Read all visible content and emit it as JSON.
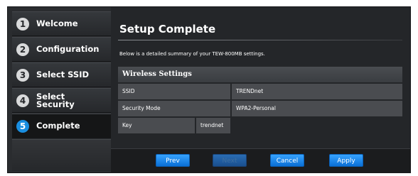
{
  "sidebar": {
    "items": [
      {
        "number": "1",
        "label": "Welcome"
      },
      {
        "number": "2",
        "label": "Configuration"
      },
      {
        "number": "3",
        "label": "Select SSID"
      },
      {
        "number": "4",
        "label": "Select\nSecurity"
      },
      {
        "number": "5",
        "label": "Complete"
      }
    ]
  },
  "main": {
    "title": "Setup Complete",
    "subtitle": "Below is a detailed summary of your TEW-800MB settings.",
    "table": {
      "header": "Wireless Settings",
      "rows": [
        {
          "label": "SSID",
          "value": "TRENDnet"
        },
        {
          "label": "Security Mode",
          "value": "WPA2-Personal"
        },
        {
          "label": "Key",
          "value": "trendnet"
        }
      ]
    }
  },
  "buttons": {
    "prev": "Prev",
    "next": "Next",
    "cancel": "Cancel",
    "apply": "Apply"
  },
  "colors": {
    "accent": "#1a8ee0",
    "panel": "#242629"
  }
}
